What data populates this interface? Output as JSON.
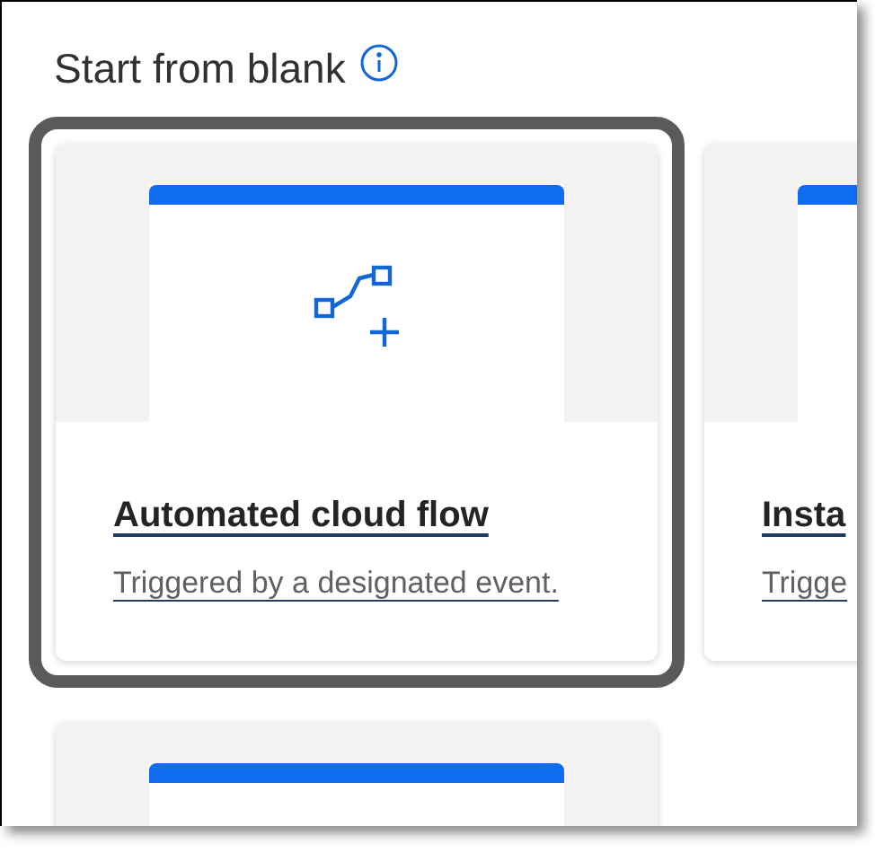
{
  "section": {
    "title": "Start from blank"
  },
  "cards": [
    {
      "kind": "automated",
      "title": "Automated cloud flow",
      "description": "Triggered by a designated event.",
      "selected": true
    },
    {
      "kind": "instant",
      "title": "Insta",
      "description": "Trigge",
      "selected": false
    },
    {
      "selected": false
    }
  ]
}
